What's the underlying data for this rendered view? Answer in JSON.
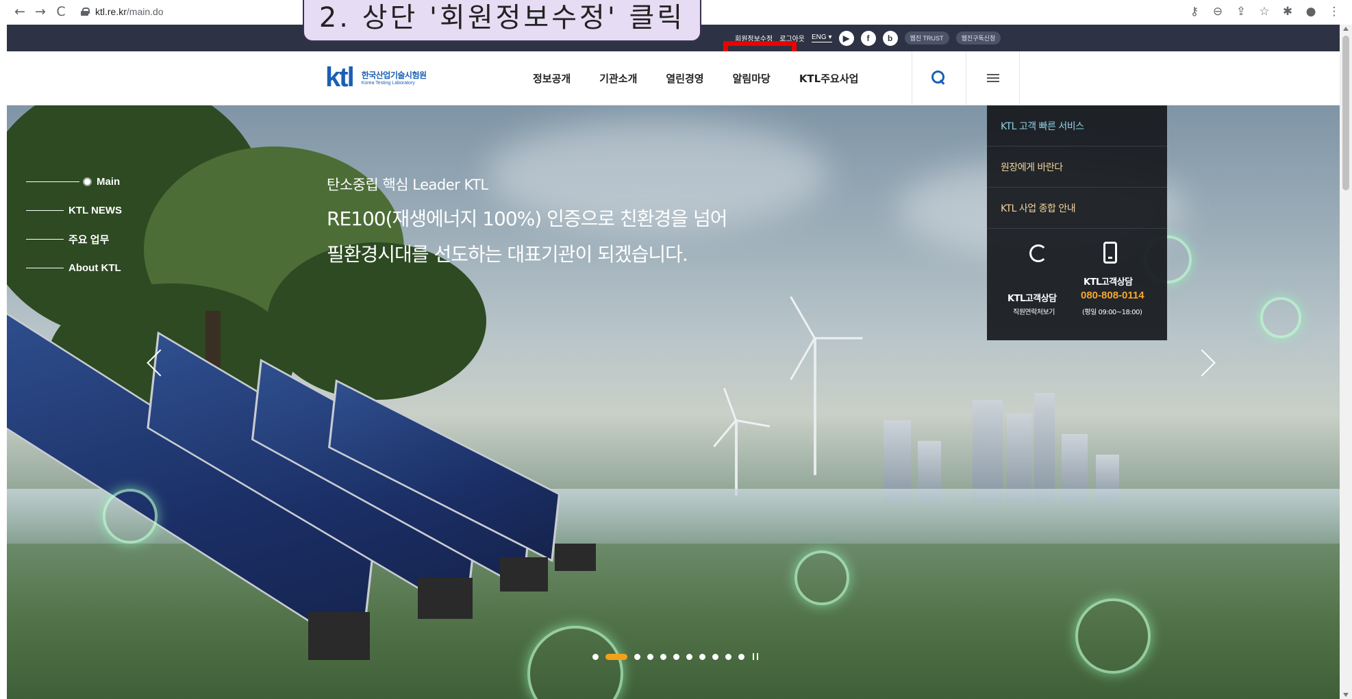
{
  "browser": {
    "url_host": "ktl.re.kr",
    "url_path": "/main.do",
    "back_glyph": "←",
    "forward_glyph": "→",
    "reload_glyph": "C",
    "icons": [
      "key-icon",
      "zoom-icon",
      "share-icon",
      "bookmark-star-icon",
      "extensions-icon",
      "profile-icon",
      "more-icon"
    ]
  },
  "annotation": {
    "text": "2. 상단 '회원정보수정' 클릭"
  },
  "utility_bar": {
    "member_edit": "회원정보수정",
    "logout": "로그아웃",
    "language": "ENG",
    "sns": {
      "youtube": "▶",
      "facebook": "f",
      "blog": "b"
    },
    "webzine": "웹진 TRUST",
    "subscribe": "웹진구독신청"
  },
  "header": {
    "logo_mark": "ktl",
    "logo_ko": "한국산업기술시험원",
    "logo_en": "Korea Testing Laboratory",
    "nav": [
      "정보공개",
      "기관소개",
      "열린경영",
      "알림마당",
      "KTL주요사업"
    ]
  },
  "hero": {
    "eyebrow": "탄소중립 핵심 Leader KTL",
    "title_line1": "RE100(재생에너지 100%) 인증으로 친환경을 넘어",
    "title_line2": "필환경시대를 선도하는 대표기관이 되겠습니다.",
    "side_nav": [
      "Main",
      "KTL NEWS",
      "주요 업무",
      "About KTL"
    ],
    "slide_count": 11,
    "active_slide": 2
  },
  "quick_service": {
    "links": [
      "KTL 고객 빠른 서비스",
      "원장에게 바란다",
      "KTL 사업 종합 안내"
    ],
    "staff_label": "KTL고객상담",
    "staff_sub": "직원연락처보기",
    "phone_label": "KTL고객상담",
    "phone_number": "080-808-0114",
    "phone_hours": "(평일 09:00~18:00)"
  },
  "colors": {
    "brand_blue": "#1b5fb4",
    "utility_bg": "#2d3344",
    "highlight": "#ee0000",
    "accent_orange": "#f3a11b"
  }
}
